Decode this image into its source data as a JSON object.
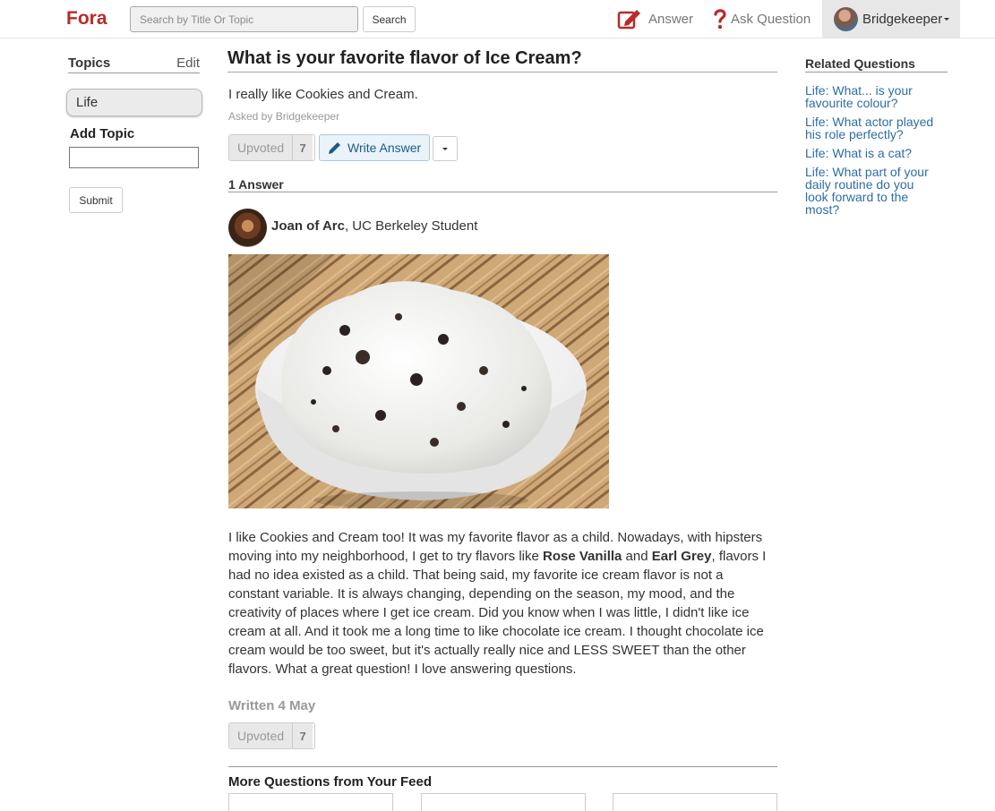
{
  "header": {
    "brand": "Fora",
    "search_placeholder": "Search by Title Or Topic",
    "search_button": "Search",
    "answer_link": "Answer",
    "ask_link": "Ask Question",
    "user_name": "Bridgekeeper",
    "brand_color": "#b92b27"
  },
  "left_sidebar": {
    "topics_heading": "Topics",
    "edit_label": "Edit",
    "topics": [
      "Life"
    ],
    "add_topic_label": "Add Topic",
    "submit_label": "Submit"
  },
  "question": {
    "title": "What is your favorite flavor of Ice Cream?",
    "body": "I really like Cookies and Cream.",
    "asked_by": "Asked by Bridgekeeper",
    "upvote_label": "Upvoted",
    "upvote_count": "7",
    "write_answer_label": "Write Answer"
  },
  "answers": {
    "count_heading": "1 Answer",
    "items": [
      {
        "author_name": "Joan of Arc",
        "author_credential": ", UC Berkeley Student",
        "text_parts": [
          "I like Cookies and Cream too! It was my favorite flavor as a child. Nowadays, with hipsters moving into my neighborhood, I get to try flavors like ",
          "Rose Vanilla",
          " and ",
          "Earl Grey",
          ", flavors I had no idea existed as a child. That being said, my favorite ice cream flavor is not a constant variable. It is always changing, depending on the season, my mood, and the creativity of places where I get ice cream. Did you know when I was little, I didn't like ice cream at all. And it took me a long time to like chocolate ice cream. I thought chocolate ice cream would be too sweet, but it's actually really nice and LESS SWEET than the other flavors. What a great question! I love answering questions."
        ],
        "written": "Written 4 May",
        "upvote_label": "Upvoted",
        "upvote_count": "7"
      }
    ]
  },
  "more_questions": {
    "heading": "More Questions from Your Feed"
  },
  "related": {
    "heading": "Related Questions",
    "items": [
      "Life: What... is your favourite colour?",
      "Life: What actor played his role perfectly?",
      "Life: What is a cat?",
      "Life: What part of your daily routine do you look forward to the most?"
    ],
    "link_color": "#2e6da4"
  }
}
